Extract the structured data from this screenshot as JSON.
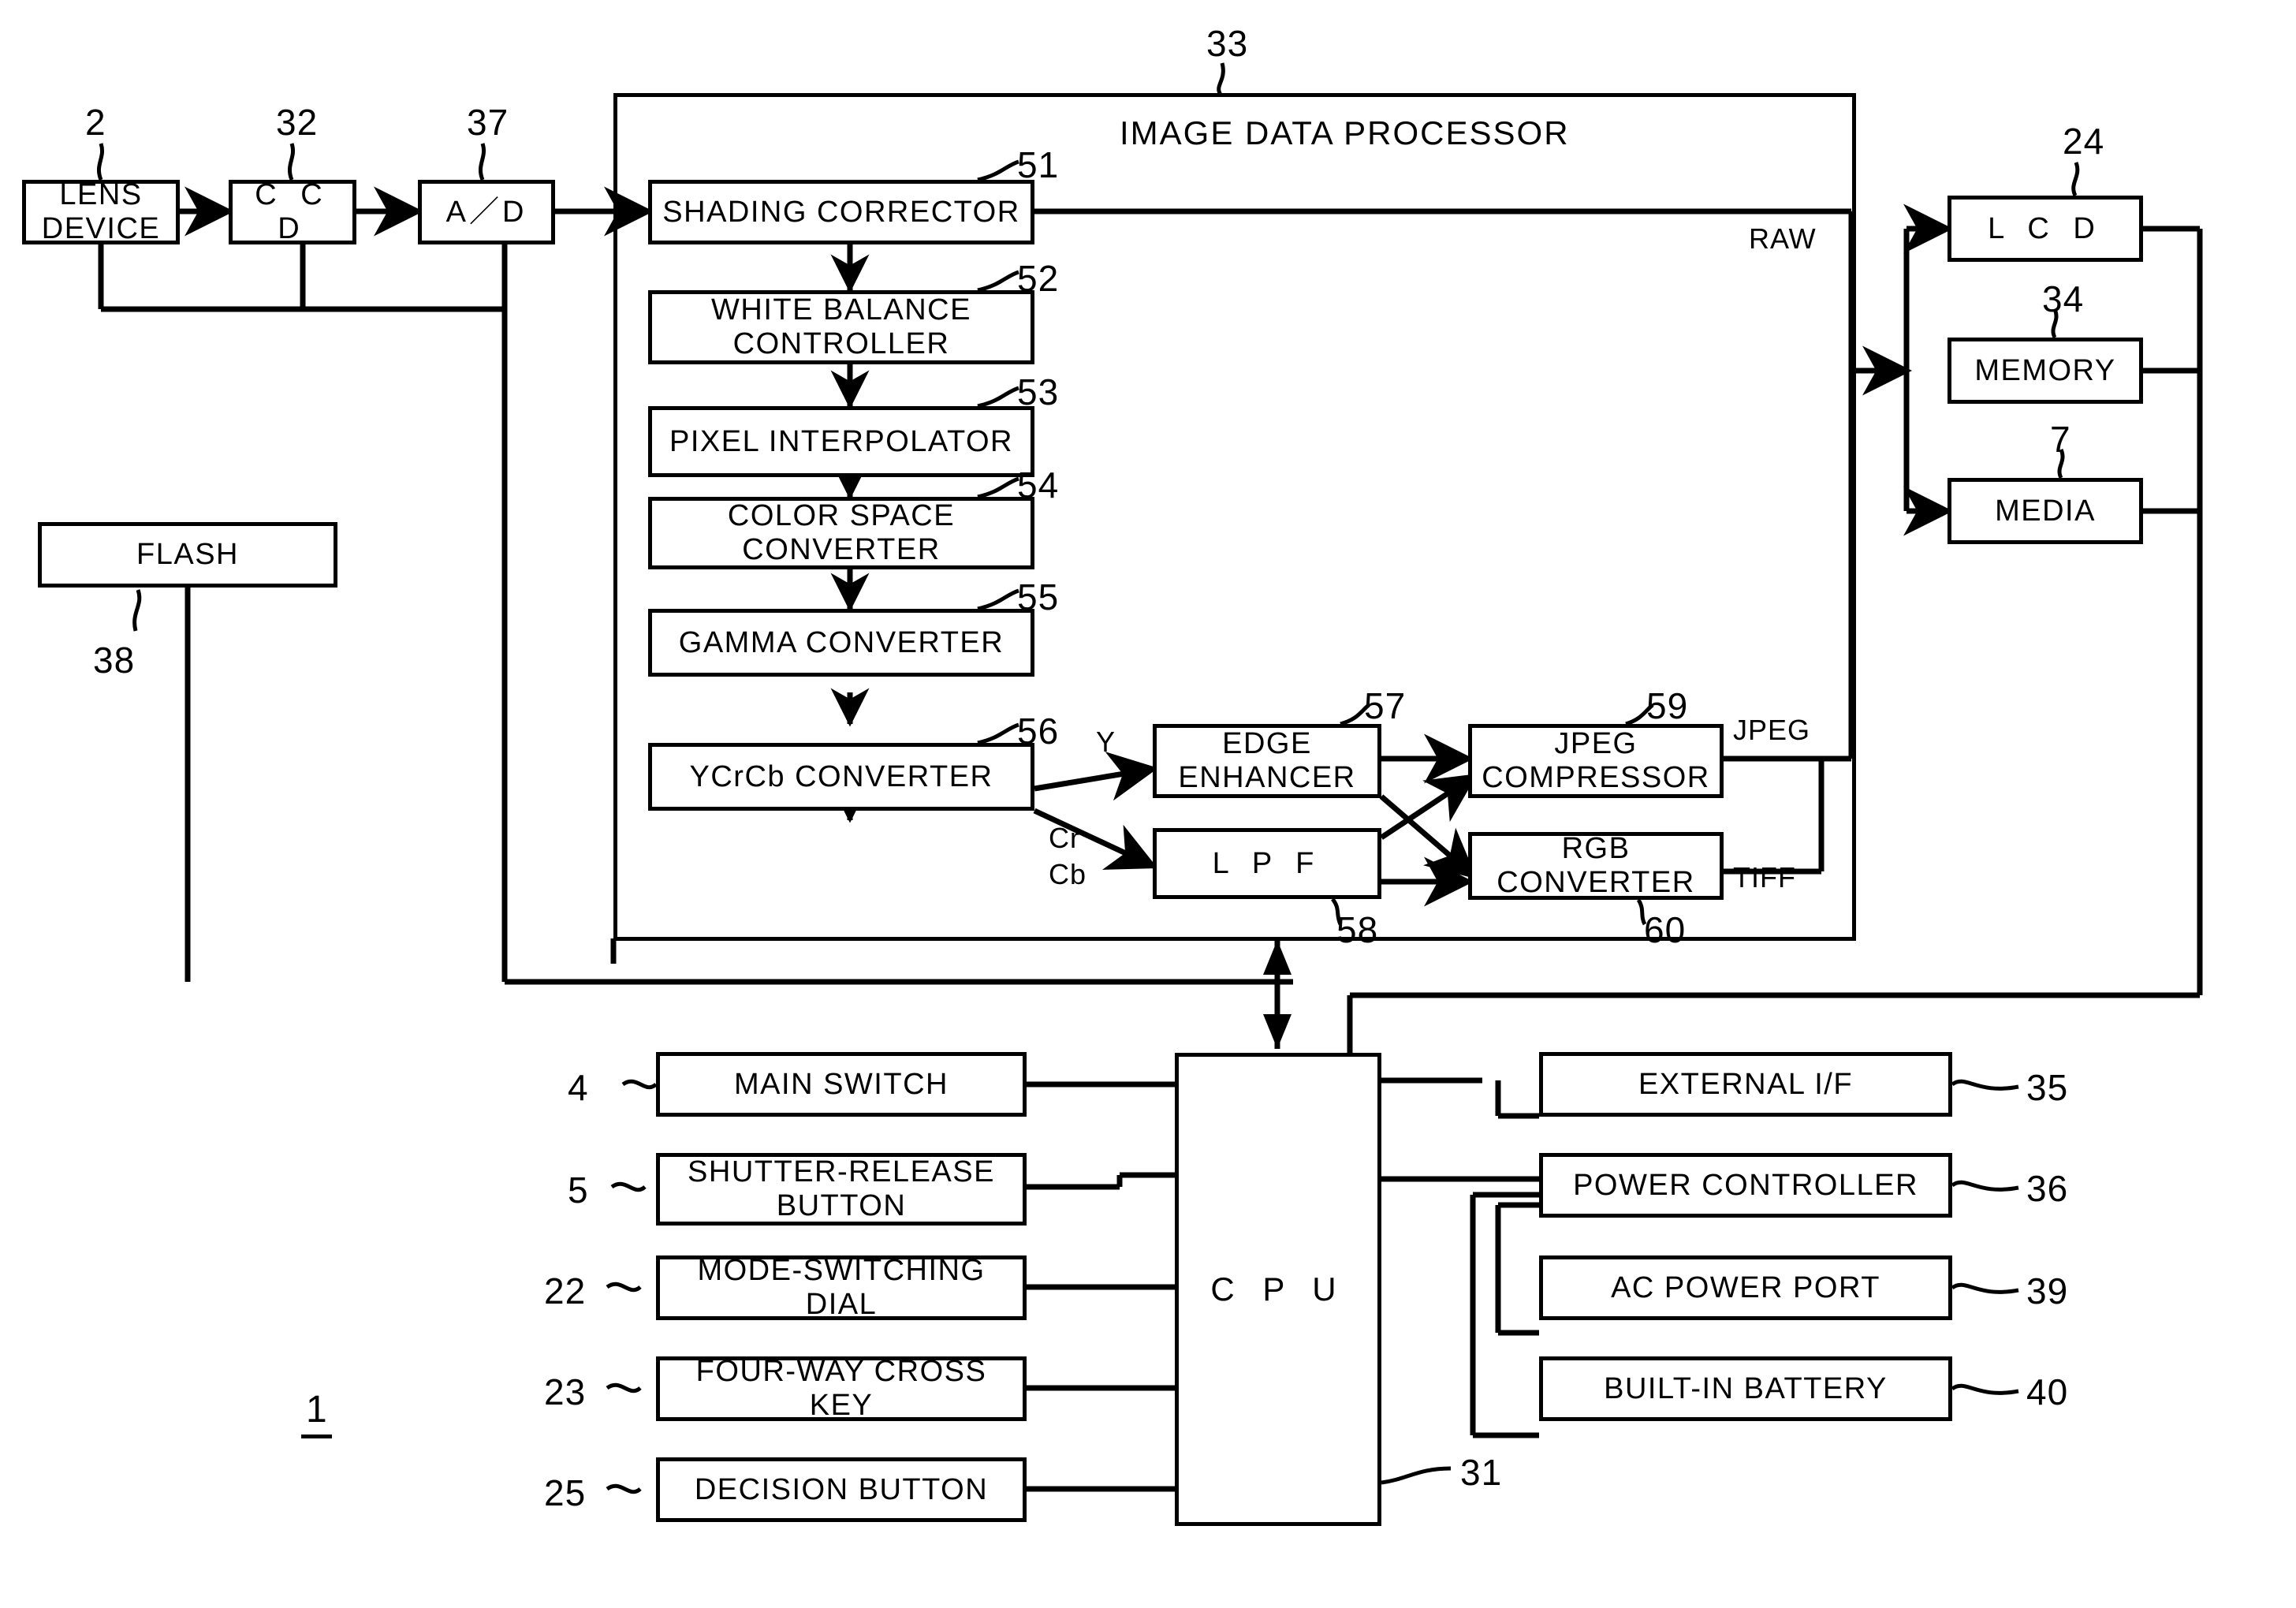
{
  "figure": {
    "figure_number": "1",
    "container_title": "IMAGE DATA PROCESSOR",
    "container_ref": "33"
  },
  "blocks": {
    "lens_device": {
      "label": "LENS\nDEVICE",
      "ref": "2"
    },
    "ccd": {
      "label": "C C D",
      "ref": "32"
    },
    "ad": {
      "label": "A／D",
      "ref": "37"
    },
    "flash": {
      "label": "FLASH",
      "ref": "38"
    },
    "shading_corrector": {
      "label": "SHADING CORRECTOR",
      "ref": "51"
    },
    "white_balance_controller": {
      "label": "WHITE BALANCE\nCONTROLLER",
      "ref": "52"
    },
    "pixel_interpolator": {
      "label": "PIXEL INTERPOLATOR",
      "ref": "53"
    },
    "color_space_converter": {
      "label": "COLOR SPACE\nCONVERTER",
      "ref": "54"
    },
    "gamma_converter": {
      "label": "GAMMA CONVERTER",
      "ref": "55"
    },
    "ycrcb_converter": {
      "label": "YCrCb CONVERTER",
      "ref": "56"
    },
    "edge_enhancer": {
      "label": "EDGE\nENHANCER",
      "ref": "57"
    },
    "lpf": {
      "label": "L P F",
      "ref": "58"
    },
    "jpeg_compressor": {
      "label": "JPEG\nCOMPRESSOR",
      "ref": "59"
    },
    "rgb_converter": {
      "label": "RGB CONVERTER",
      "ref": "60"
    },
    "lcd": {
      "label": "L C D",
      "ref": "24"
    },
    "memory": {
      "label": "MEMORY",
      "ref": "34"
    },
    "media": {
      "label": "MEDIA",
      "ref": "7"
    },
    "cpu": {
      "label": "C P U",
      "ref": "31"
    },
    "main_switch": {
      "label": "MAIN SWITCH",
      "ref": "4"
    },
    "shutter_release_button": {
      "label": "SHUTTER-RELEASE\nBUTTON",
      "ref": "5"
    },
    "mode_switching_dial": {
      "label": "MODE-SWITCHING DIAL",
      "ref": "22"
    },
    "four_way_cross_key": {
      "label": "FOUR-WAY CROSS KEY",
      "ref": "23"
    },
    "decision_button": {
      "label": "DECISION BUTTON",
      "ref": "25"
    },
    "external_if": {
      "label": "EXTERNAL I/F",
      "ref": "35"
    },
    "power_controller": {
      "label": "POWER CONTROLLER",
      "ref": "36"
    },
    "ac_power_port": {
      "label": "AC POWER PORT",
      "ref": "39"
    },
    "built_in_battery": {
      "label": "BUILT-IN BATTERY",
      "ref": "40"
    }
  },
  "signal_labels": {
    "raw": "RAW",
    "y": "Y",
    "cr": "Cr",
    "cb": "Cb",
    "jpeg": "JPEG",
    "tiff": "TIFF"
  }
}
